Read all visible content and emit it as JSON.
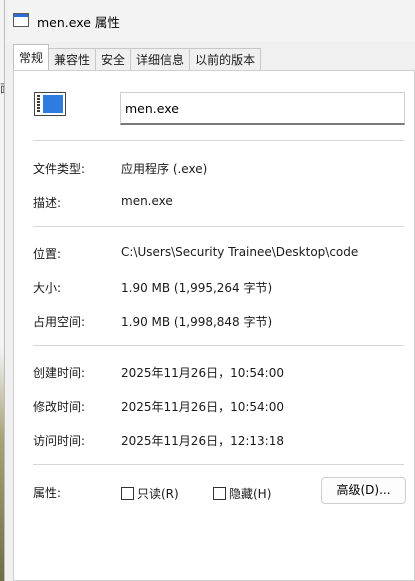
{
  "window": {
    "title": "men.exe 属性",
    "background_fragment": "面"
  },
  "tabs": [
    {
      "label": "常规",
      "active": true
    },
    {
      "label": "兼容性",
      "active": false
    },
    {
      "label": "安全",
      "active": false
    },
    {
      "label": "详细信息",
      "active": false
    },
    {
      "label": "以前的版本",
      "active": false
    }
  ],
  "general": {
    "filename": "men.exe",
    "file_type_label": "文件类型:",
    "file_type_value": "应用程序 (.exe)",
    "description_label": "描述:",
    "description_value": "men.exe",
    "location_label": "位置:",
    "location_value": "C:\\Users\\Security Trainee\\Desktop\\code",
    "size_label": "大小:",
    "size_value": "1.90 MB (1,995,264 字节)",
    "size_on_disk_label": "占用空间:",
    "size_on_disk_value": "1.90 MB (1,998,848 字节)",
    "created_label": "创建时间:",
    "created_value": "2025年11月26日，10:54:00",
    "modified_label": "修改时间:",
    "modified_value": "2025年11月26日，10:54:00",
    "accessed_label": "访问时间:",
    "accessed_value": "2025年11月26日，12:13:18",
    "attributes_label": "属性:",
    "readonly_label": "只读(R)",
    "readonly_checked": false,
    "hidden_label": "隐藏(H)",
    "hidden_checked": false,
    "advanced_button": "高级(D)..."
  }
}
